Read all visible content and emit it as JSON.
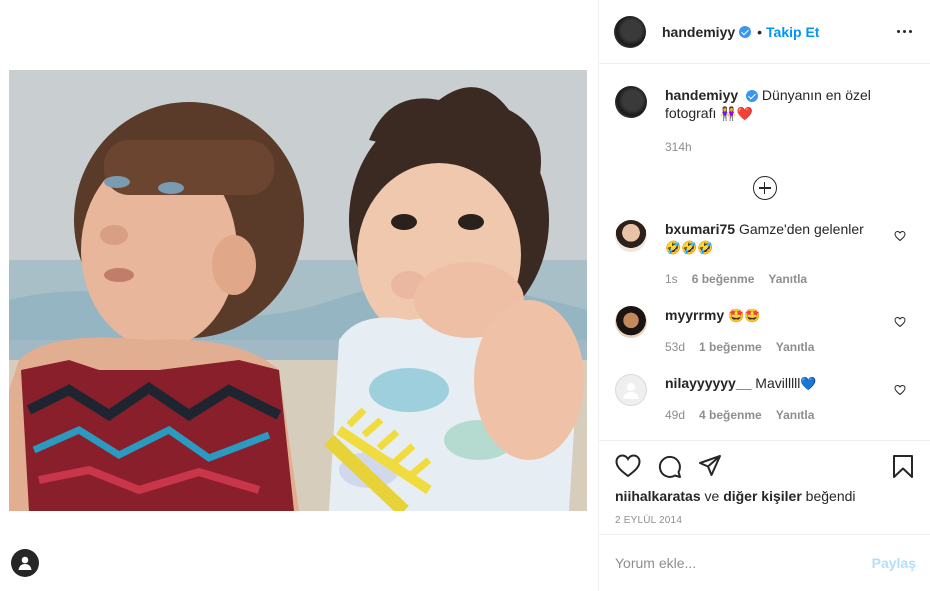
{
  "post": {
    "username": "handemiyy",
    "follow_label": "Takip Et",
    "dot": "•"
  },
  "caption": {
    "username": "handemiyy",
    "text": "Dünyanın en özel fotografı",
    "emoji": "👭❤️",
    "time": "314h"
  },
  "comments": [
    {
      "username": "bxumari75",
      "text": "Gamze'den gelenler",
      "emoji": "🤣🤣🤣",
      "time": "1s",
      "likes": "6 beğenme",
      "reply": "Yanıtla"
    },
    {
      "username": "myyrrmy",
      "text": "",
      "emoji": "🤩🤩",
      "time": "53d",
      "likes": "1 beğenme",
      "reply": "Yanıtla"
    },
    {
      "username": "nilayyyyyy__",
      "text": "Mavilllll",
      "emoji": "💙",
      "time": "49d",
      "likes": "4 beğenme",
      "reply": "Yanıtla"
    }
  ],
  "likes": {
    "user": "niihalkaratas",
    "connector": "ve",
    "others": "diğer kişiler",
    "suffix": "beğendi"
  },
  "date": "2 EYLÜL 2014",
  "add_comment": {
    "placeholder": "Yorum ekle...",
    "post_label": "Paylaş"
  },
  "colors": {
    "link": "#0095f6",
    "verified": "#3897f0",
    "muted": "#8e8e8e",
    "post_disabled": "#b2dffc"
  },
  "icons": {
    "like": "heart-icon",
    "comment": "comment-icon",
    "share": "paper-plane-icon",
    "save": "bookmark-icon",
    "more": "more-options-icon",
    "load_more": "plus-circle-icon",
    "profile": "profile-icon"
  }
}
